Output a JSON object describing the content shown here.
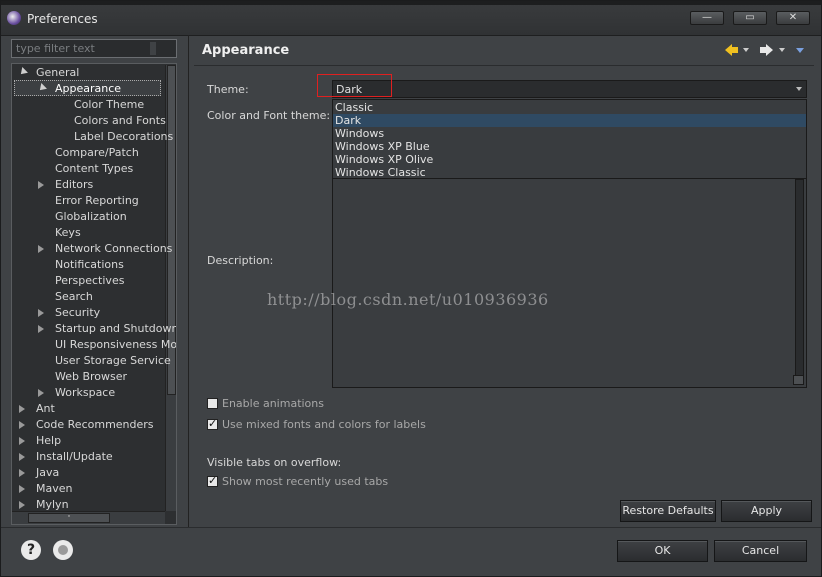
{
  "window": {
    "title": "Preferences",
    "minimize_label": "—",
    "maximize_label": "▭",
    "close_label": "✕"
  },
  "filter": {
    "placeholder": "type filter text"
  },
  "tree": {
    "items": [
      {
        "label": "General",
        "level": 0,
        "state": "open"
      },
      {
        "label": "Appearance",
        "level": 1,
        "state": "open",
        "selected": true
      },
      {
        "label": "Color Theme",
        "level": 2,
        "state": "leaf"
      },
      {
        "label": "Colors and Fonts",
        "level": 2,
        "state": "leaf"
      },
      {
        "label": "Label Decorations",
        "level": 2,
        "state": "leaf"
      },
      {
        "label": "Compare/Patch",
        "level": 1,
        "state": "leaf"
      },
      {
        "label": "Content Types",
        "level": 1,
        "state": "leaf"
      },
      {
        "label": "Editors",
        "level": 1,
        "state": "closed"
      },
      {
        "label": "Error Reporting",
        "level": 1,
        "state": "leaf"
      },
      {
        "label": "Globalization",
        "level": 1,
        "state": "leaf"
      },
      {
        "label": "Keys",
        "level": 1,
        "state": "leaf"
      },
      {
        "label": "Network Connections",
        "level": 1,
        "state": "closed"
      },
      {
        "label": "Notifications",
        "level": 1,
        "state": "leaf"
      },
      {
        "label": "Perspectives",
        "level": 1,
        "state": "leaf"
      },
      {
        "label": "Search",
        "level": 1,
        "state": "leaf"
      },
      {
        "label": "Security",
        "level": 1,
        "state": "closed"
      },
      {
        "label": "Startup and Shutdown",
        "level": 1,
        "state": "closed"
      },
      {
        "label": "UI Responsiveness Monitoring",
        "level": 1,
        "state": "leaf"
      },
      {
        "label": "User Storage Service",
        "level": 1,
        "state": "leaf"
      },
      {
        "label": "Web Browser",
        "level": 1,
        "state": "leaf"
      },
      {
        "label": "Workspace",
        "level": 1,
        "state": "closed"
      },
      {
        "label": "Ant",
        "level": 0,
        "state": "closed"
      },
      {
        "label": "Code Recommenders",
        "level": 0,
        "state": "closed"
      },
      {
        "label": "Help",
        "level": 0,
        "state": "closed"
      },
      {
        "label": "Install/Update",
        "level": 0,
        "state": "closed"
      },
      {
        "label": "Java",
        "level": 0,
        "state": "closed"
      },
      {
        "label": "Maven",
        "level": 0,
        "state": "closed"
      },
      {
        "label": "Mylyn",
        "level": 0,
        "state": "closed"
      }
    ],
    "hscroll_thumb_label": "\""
  },
  "page": {
    "title": "Appearance",
    "theme_label": "Theme:",
    "theme_value": "Dark",
    "color_font_theme_label": "Color and Font theme:",
    "description_label": "Description:",
    "theme_options": [
      "Classic",
      "Dark",
      "Windows",
      "Windows XP Blue",
      "Windows XP Olive",
      "Windows Classic"
    ],
    "highlighted_option": "Dark",
    "watermark": "http://blog.csdn.net/u010936936",
    "enable_animations": {
      "label": "Enable animations",
      "checked": false
    },
    "mixed_fonts": {
      "label": "Use mixed fonts and colors for labels",
      "checked": true
    },
    "visible_tabs_label": "Visible tabs on overflow:",
    "recent_tabs": {
      "label": "Show most recently used tabs",
      "checked": true
    },
    "restore_defaults_label": "Restore Defaults",
    "apply_label": "Apply"
  },
  "footer": {
    "help_icon_glyph": "?",
    "ok_label": "OK",
    "cancel_label": "Cancel"
  },
  "colors": {
    "background": "#3f4245",
    "tree_background": "#2d2f31",
    "highlight": "#2f4a63",
    "annotation_box": "#e02020",
    "back_arrow": "#f0c020"
  }
}
